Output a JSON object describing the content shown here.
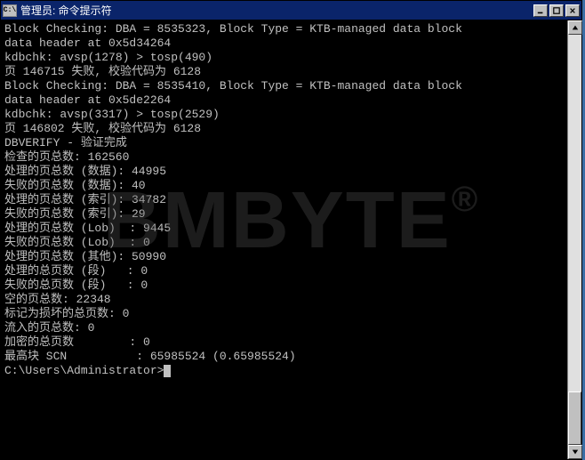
{
  "window": {
    "title": "管理员: 命令提示符",
    "icon_label": "C:\\"
  },
  "watermark": {
    "text": "BMBYTE",
    "symbol": "®"
  },
  "console": {
    "lines": [
      "Block Checking: DBA = 8535323, Block Type = KTB-managed data block",
      "data header at 0x5d34264",
      "kdbchk: avsp(1278) > tosp(490)",
      "页 146715 失败, 校验代码为 6128",
      "Block Checking: DBA = 8535410, Block Type = KTB-managed data block",
      "data header at 0x5de2264",
      "kdbchk: avsp(3317) > tosp(2529)",
      "页 146802 失败, 校验代码为 6128",
      "",
      "",
      "DBVERIFY - 验证完成",
      "",
      "检查的页总数: 162560",
      "处理的页总数 (数据): 44995",
      "失败的页总数 (数据): 40",
      "处理的页总数 (索引): 34782",
      "失败的页总数 (索引): 29",
      "处理的页总数 (Lob)  : 9445",
      "失败的页总数 (Lob)  : 0",
      "处理的页总数 (其他): 50990",
      "处理的总页数 (段)   : 0",
      "失败的总页数 (段)   : 0",
      "空的页总数: 22348",
      "标记为损坏的总页数: 0",
      "流入的页总数: 0",
      "加密的总页数        : 0",
      "最高块 SCN          : 65985524 (0.65985524)",
      "",
      "C:\\Users\\Administrator>"
    ]
  }
}
